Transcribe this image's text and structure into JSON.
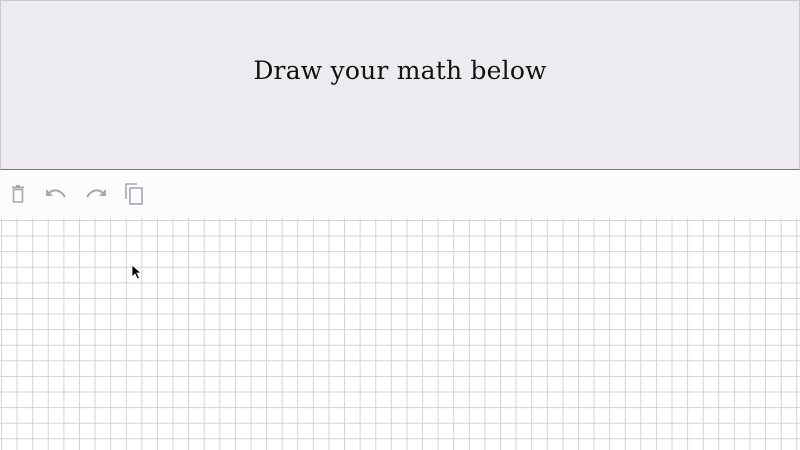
{
  "preview": {
    "prompt_text": "Draw your math below"
  },
  "toolbar": {
    "buttons": [
      {
        "name": "clear",
        "icon": "trash-icon"
      },
      {
        "name": "undo",
        "icon": "undo-icon"
      },
      {
        "name": "redo",
        "icon": "redo-icon"
      },
      {
        "name": "copy",
        "icon": "copy-icon"
      }
    ],
    "icon_color": "#a9a8ad"
  },
  "canvas": {
    "background": "#ffffff",
    "grid_color": "#d3d2d6"
  },
  "colors": {
    "preview_background": "#edebf0",
    "toolbar_background": "#fcfbfe",
    "divider": "#7a797c"
  }
}
